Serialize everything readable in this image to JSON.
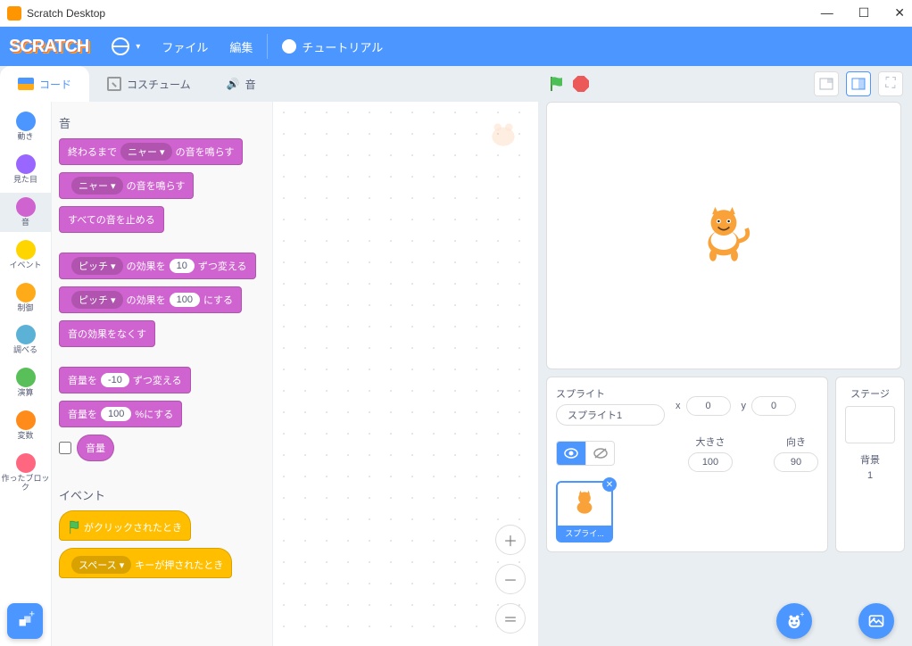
{
  "window": {
    "title": "Scratch Desktop"
  },
  "menu": {
    "file": "ファイル",
    "edit": "編集",
    "tutorials": "チュートリアル"
  },
  "tabs": {
    "code": "コード",
    "costumes": "コスチューム",
    "sounds": "音"
  },
  "categories": [
    {
      "label": "動き",
      "color": "#4c97ff"
    },
    {
      "label": "見た目",
      "color": "#9966ff"
    },
    {
      "label": "音",
      "color": "#cf63cf",
      "active": true
    },
    {
      "label": "イベント",
      "color": "#ffd500"
    },
    {
      "label": "制御",
      "color": "#ffab19"
    },
    {
      "label": "調べる",
      "color": "#5cb1d6"
    },
    {
      "label": "演算",
      "color": "#59c059"
    },
    {
      "label": "変数",
      "color": "#ff8c1a"
    },
    {
      "label": "作ったブロック",
      "color": "#ff6680"
    }
  ],
  "palette": {
    "sound_title": "音",
    "event_title": "イベント",
    "b1_pre": "終わるまで",
    "b1_dd": "ニャー ▾",
    "b1_post": "の音を鳴らす",
    "b2_dd": "ニャー ▾",
    "b2_post": "の音を鳴らす",
    "b3": "すべての音を止める",
    "b4_dd": "ピッチ ▾",
    "b4_mid": "の効果を",
    "b4_val": "10",
    "b4_post": "ずつ変える",
    "b5_dd": "ピッチ ▾",
    "b5_mid": "の効果を",
    "b5_val": "100",
    "b5_post": "にする",
    "b6": "音の効果をなくす",
    "b7_pre": "音量を",
    "b7_val": "-10",
    "b7_post": "ずつ変える",
    "b8_pre": "音量を",
    "b8_val": "100",
    "b8_post": "%にする",
    "b9": "音量",
    "ev1": "がクリックされたとき",
    "ev2_dd": "スペース ▾",
    "ev2_post": "キーが押されたとき"
  },
  "sprite_info": {
    "label": "スプライト",
    "name": "スプライト1",
    "x_label": "x",
    "x": "0",
    "y_label": "y",
    "y": "0",
    "size_label": "大きさ",
    "size": "100",
    "dir_label": "向き",
    "dir": "90"
  },
  "stage_panel": {
    "title": "ステージ",
    "backdrop_label": "背景",
    "count": "1"
  },
  "sprite_thumb": {
    "name": "スプライ..."
  }
}
